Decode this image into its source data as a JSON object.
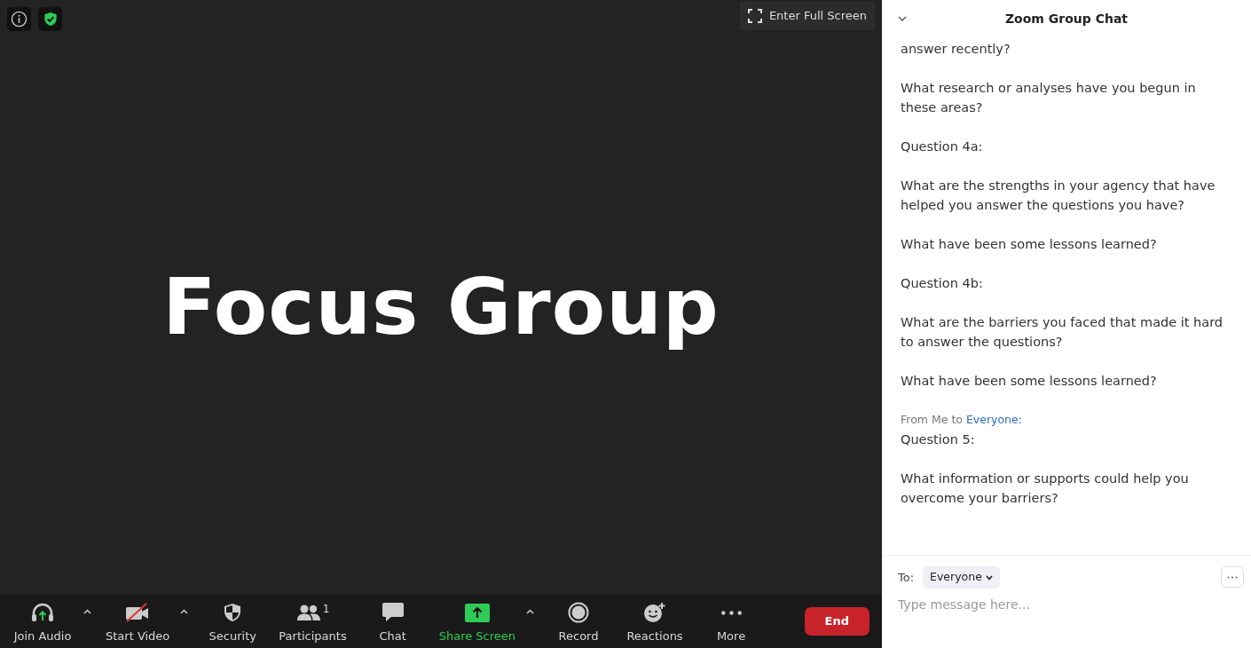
{
  "meeting": {
    "fullscreen_button": "Enter Full Screen",
    "shared_title": "Focus Group"
  },
  "toolbar": [
    {
      "kind": "audio",
      "label": "Join Audio",
      "caret": true,
      "highlight": false
    },
    {
      "kind": "video",
      "label": "Start Video",
      "caret": true,
      "highlight": false
    },
    {
      "kind": "security",
      "label": "Security",
      "caret": false,
      "highlight": false
    },
    {
      "kind": "participants",
      "label": "Participants",
      "count": "1",
      "caret": false,
      "highlight": false
    },
    {
      "kind": "chat",
      "label": "Chat",
      "caret": false,
      "highlight": false
    },
    {
      "kind": "share",
      "label": "Share Screen",
      "caret": true,
      "highlight": true
    },
    {
      "kind": "record",
      "label": "Record",
      "caret": false,
      "highlight": false
    },
    {
      "kind": "reactions",
      "label": "Reactions",
      "caret": false,
      "highlight": false
    },
    {
      "kind": "more",
      "label": "More",
      "caret": false,
      "highlight": false
    }
  ],
  "end_button": "End",
  "chat": {
    "title": "Zoom Group Chat",
    "messages": [
      {
        "kind": "text",
        "text": "answer recently?"
      },
      {
        "kind": "text",
        "text": "What research or analyses have you begun in these areas?"
      },
      {
        "kind": "text",
        "text": "Question 4a:"
      },
      {
        "kind": "text",
        "text": "What are the strengths in your agency that have helped you answer the questions you have?"
      },
      {
        "kind": "text",
        "text": "What have been some lessons learned?"
      },
      {
        "kind": "text",
        "text": "Question 4b:"
      },
      {
        "kind": "text",
        "text": "What are the barriers you faced that made it hard to answer the questions?"
      },
      {
        "kind": "text",
        "text": "What have been some lessons learned?"
      },
      {
        "kind": "sender",
        "from": "From Me to",
        "to": "Everyone:"
      },
      {
        "kind": "text",
        "text": "Question 5:"
      },
      {
        "kind": "text",
        "text": "What information or supports could help you overcome your barriers?"
      }
    ],
    "to_label": "To:",
    "recipient": "Everyone",
    "placeholder": "Type message here..."
  }
}
